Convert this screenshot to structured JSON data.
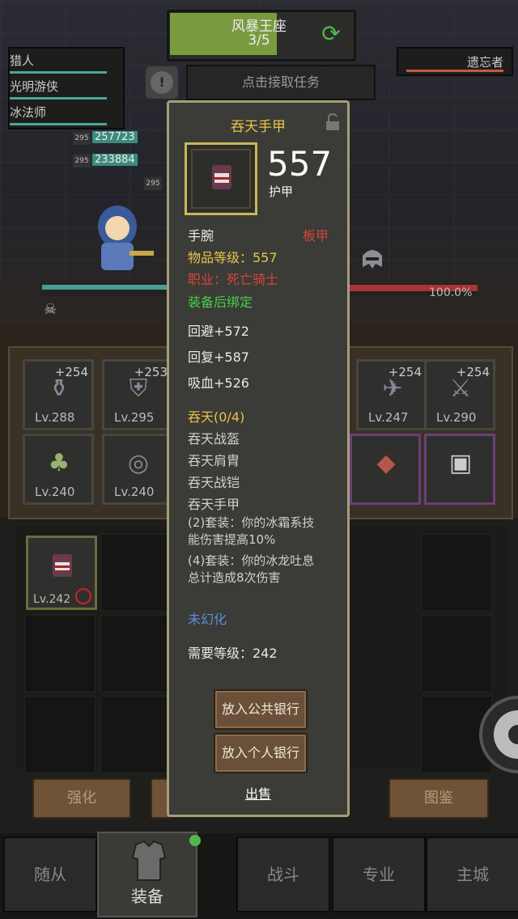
{
  "quest": {
    "name": "风暴王座",
    "progress": "3/5",
    "fraction": 0.6
  },
  "party": [
    {
      "name": "猎人"
    },
    {
      "name": "光明游侠"
    },
    {
      "name": "冰法师"
    }
  ],
  "enemy": {
    "name": "遗忘者"
  },
  "task_button": "点击接取任务",
  "damage": [
    {
      "level": "295",
      "value": "257723"
    },
    {
      "level": "295",
      "value": "233884"
    },
    {
      "level": "295",
      "value": ""
    }
  ],
  "hp_percent": "100.0%",
  "equip_slots": [
    {
      "plus": "+254",
      "level": "Lv.288"
    },
    {
      "plus": "+253",
      "level": "Lv.295"
    },
    {
      "plus": "+254",
      "level": "Lv.247"
    },
    {
      "plus": "+254",
      "level": "Lv.290"
    },
    {
      "plus": "",
      "level": "Lv.240"
    },
    {
      "plus": "",
      "level": "Lv.240"
    },
    {
      "plus": "",
      "level": ""
    },
    {
      "plus": "",
      "level": ""
    }
  ],
  "bag_item": {
    "level": "Lv.242"
  },
  "action_buttons": {
    "enhance": "强化",
    "codex": "图鉴"
  },
  "nav": {
    "follower": "随从",
    "equipment": "装备",
    "battle": "战斗",
    "profession": "专业",
    "main_city": "主城"
  },
  "tooltip": {
    "name": "吞天手甲",
    "armor": "557",
    "armor_label": "护甲",
    "slot": "手腕",
    "material": "板甲",
    "item_level": "物品等级：557",
    "class": "职业：死亡骑士",
    "bind": "装备后绑定",
    "stats": [
      "回避+572",
      "回复+587",
      "吸血+526"
    ],
    "set_name": "吞天(0/4)",
    "set_items": [
      "吞天战盔",
      "吞天肩胄",
      "吞天战铠",
      "吞天手甲"
    ],
    "set_bonus_2_line1": "(2)套装：你的冰霜系技",
    "set_bonus_2_line2": "能伤害提高10%",
    "set_bonus_4_line1": "(4)套装：你的冰龙吐息",
    "set_bonus_4_line2": "总计造成8次伤害",
    "transmog": "未幻化",
    "required_level": "需要等级：242",
    "btn_public_bank": "放入公共银行",
    "btn_personal_bank": "放入个人银行",
    "sell": "出售"
  },
  "colors": {
    "gold": "#e8c44a",
    "red": "#d8443a",
    "green": "#46d04a",
    "blue": "#5a8fdb",
    "frame": "#a59d78"
  }
}
